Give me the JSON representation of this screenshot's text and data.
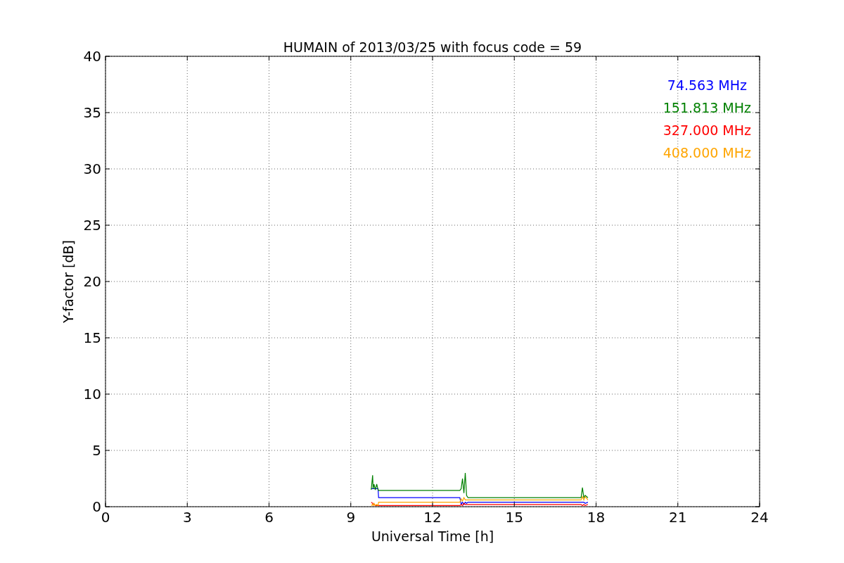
{
  "chart": {
    "chart_data": {
      "type": "line",
      "title": "HUMAIN of 2013/03/25 with focus code = 59",
      "xlabel": "Universal Time [h]",
      "ylabel": "Y-factor [dB]",
      "xlim": [
        0,
        24
      ],
      "ylim": [
        0,
        40
      ],
      "xticks": [
        0,
        3,
        6,
        9,
        12,
        15,
        18,
        21,
        24
      ],
      "yticks": [
        0,
        5,
        10,
        15,
        20,
        25,
        30,
        35,
        40
      ],
      "grid": true,
      "x": [
        9.75,
        9.8,
        9.82,
        9.85,
        9.9,
        9.95,
        10.0,
        10.02,
        13.0,
        13.05,
        13.1,
        13.15,
        13.2,
        13.25,
        13.3,
        17.45,
        17.5,
        17.55,
        17.6,
        17.7
      ],
      "series": [
        {
          "name": "74.563 MHz",
          "color": "#0000ff",
          "values": [
            1.6,
            1.6,
            1.6,
            1.6,
            1.6,
            1.6,
            1.6,
            0.8,
            0.8,
            0.2,
            0.4,
            0.2,
            0.4,
            0.3,
            0.4,
            0.4,
            0.4,
            0.4,
            0.3,
            0.4
          ]
        },
        {
          "name": "151.813 MHz",
          "color": "#008000",
          "values": [
            1.5,
            2.8,
            1.6,
            2.0,
            1.5,
            2.0,
            1.5,
            1.45,
            1.45,
            1.6,
            2.5,
            1.2,
            3.0,
            1.0,
            0.8,
            0.8,
            1.7,
            0.8,
            1.0,
            0.8
          ]
        },
        {
          "name": "327.000 MHz",
          "color": "#ff0000",
          "values": [
            0.4,
            0.3,
            0.2,
            0.2,
            0.1,
            0.1,
            0.1,
            0.1,
            0.1,
            0.2,
            0.1,
            0.3,
            0.2,
            0.2,
            0.2,
            0.2,
            0.1,
            0.2,
            0.1,
            0.2
          ]
        },
        {
          "name": "408.000 MHz",
          "color": "#ffa500",
          "values": [
            0.1,
            0.2,
            0.1,
            0.3,
            0.1,
            0.2,
            0.1,
            0.4,
            0.4,
            0.7,
            0.5,
            0.8,
            0.6,
            0.6,
            0.6,
            0.6,
            0.9,
            0.6,
            0.9,
            0.6
          ]
        }
      ]
    }
  }
}
